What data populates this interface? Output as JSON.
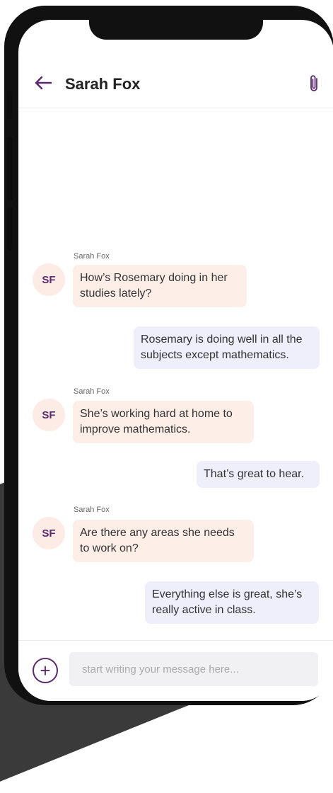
{
  "header": {
    "title": "Sarah Fox",
    "back_icon": "arrow-left-icon",
    "attach_icon": "paperclip-icon"
  },
  "messages": [
    {
      "type": "incoming",
      "sender": "Sarah Fox",
      "initials": "SF",
      "text": "How’s Rosemary doing in her studies lately?"
    },
    {
      "type": "outgoing",
      "text": "Rosemary is doing well in all the subjects except mathematics."
    },
    {
      "type": "incoming",
      "sender": "Sarah Fox",
      "initials": "SF",
      "text": "She’s working hard at home to improve mathematics."
    },
    {
      "type": "outgoing",
      "text": "That’s great to hear."
    },
    {
      "type": "incoming",
      "sender": "Sarah Fox",
      "initials": "SF",
      "text": "Are there any areas she needs to work on?"
    },
    {
      "type": "outgoing",
      "text": "Everything else is great, she’s really active in class."
    }
  ],
  "composer": {
    "placeholder": "start writing your message here...",
    "add_icon": "plus-circle-icon"
  },
  "colors": {
    "accent": "#5b2a6d",
    "incoming_bubble": "#fdeee8",
    "outgoing_bubble": "#efeefb",
    "avatar_bg": "#fdebe5"
  }
}
